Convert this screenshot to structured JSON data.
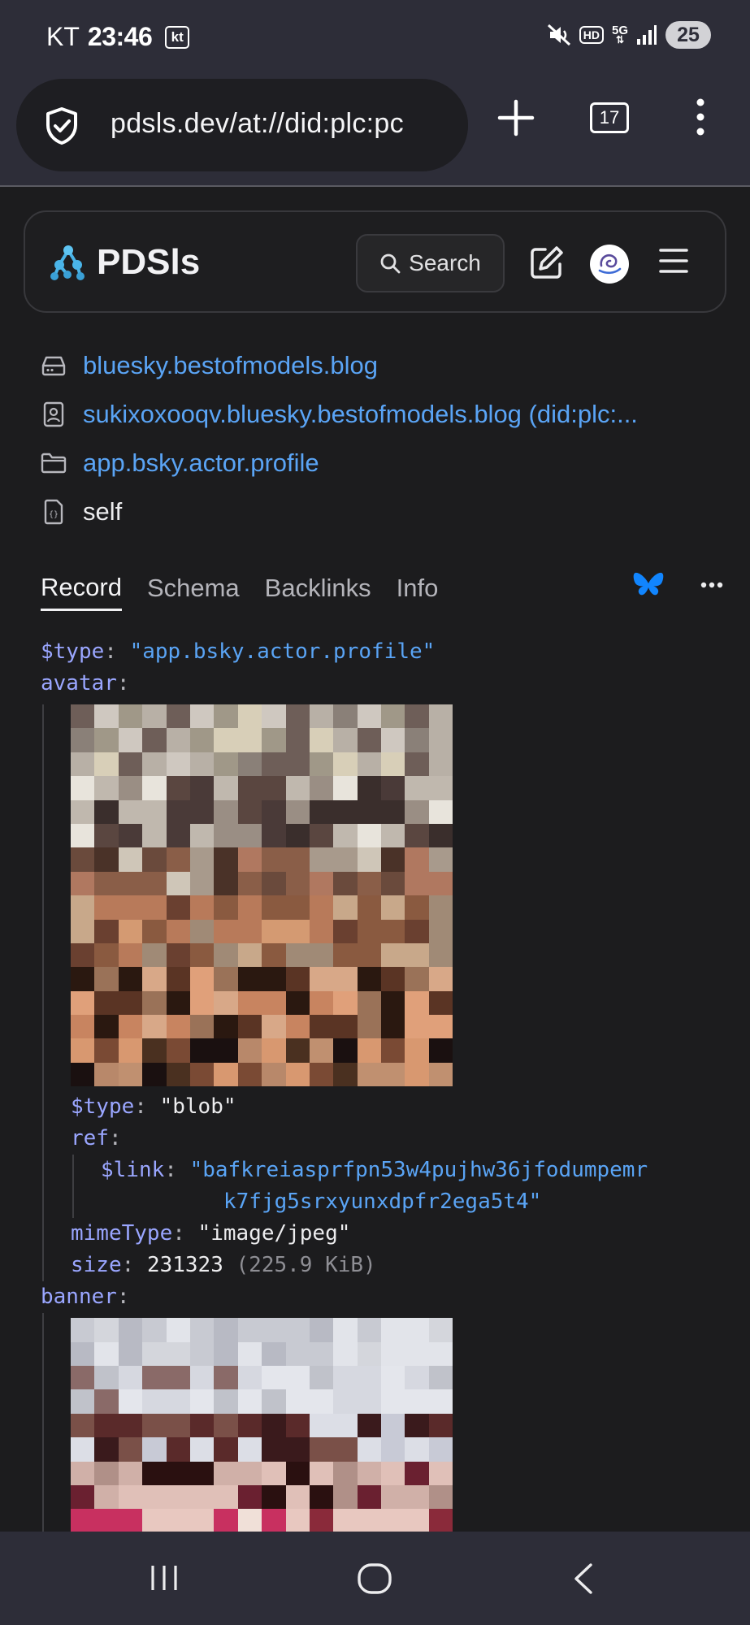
{
  "status_bar": {
    "carrier": "KT",
    "time": "23:46",
    "carrier_badge": "kt",
    "hd_label": "HD",
    "network_label": "5G",
    "battery_level": "25"
  },
  "browser": {
    "url": "pdsls.dev/at://did:plc:pc",
    "tab_count": "17"
  },
  "header": {
    "app_name": "PDSls",
    "search_label": "Search"
  },
  "breadcrumbs": [
    {
      "icon": "server-icon",
      "label": "bluesky.bestofmodels.blog"
    },
    {
      "icon": "user-card-icon",
      "label": "sukixoxooqv.bluesky.bestofmodels.blog (did:plc:..."
    },
    {
      "icon": "folder-icon",
      "label": "app.bsky.actor.profile"
    },
    {
      "icon": "json-file-icon",
      "label": "self"
    }
  ],
  "tabs": [
    {
      "label": "Record",
      "active": true
    },
    {
      "label": "Schema",
      "active": false
    },
    {
      "label": "Backlinks",
      "active": false
    },
    {
      "label": "Info",
      "active": false
    }
  ],
  "colors": {
    "link": "#5aa4f5",
    "json_key": "#9aa6ff",
    "bluesky": "#1185fe"
  },
  "record": {
    "type_key": "$type",
    "type_value": "\"app.bsky.actor.profile\"",
    "avatar_key": "avatar",
    "avatar": {
      "type_key": "$type",
      "type_value": "\"blob\"",
      "ref_key": "ref",
      "link_key": "$link",
      "link_value_line1": "\"bafkreiasprfpn53w4pujhw36jfodumpemr",
      "link_value_line2": "k7fjg5srxyunxdpfr2ega5t4\"",
      "mime_key": "mimeType",
      "mime_value": "\"image/jpeg\"",
      "size_key": "size",
      "size_value": "231323",
      "size_human": "(225.9 KiB)"
    },
    "banner_key": "banner"
  }
}
